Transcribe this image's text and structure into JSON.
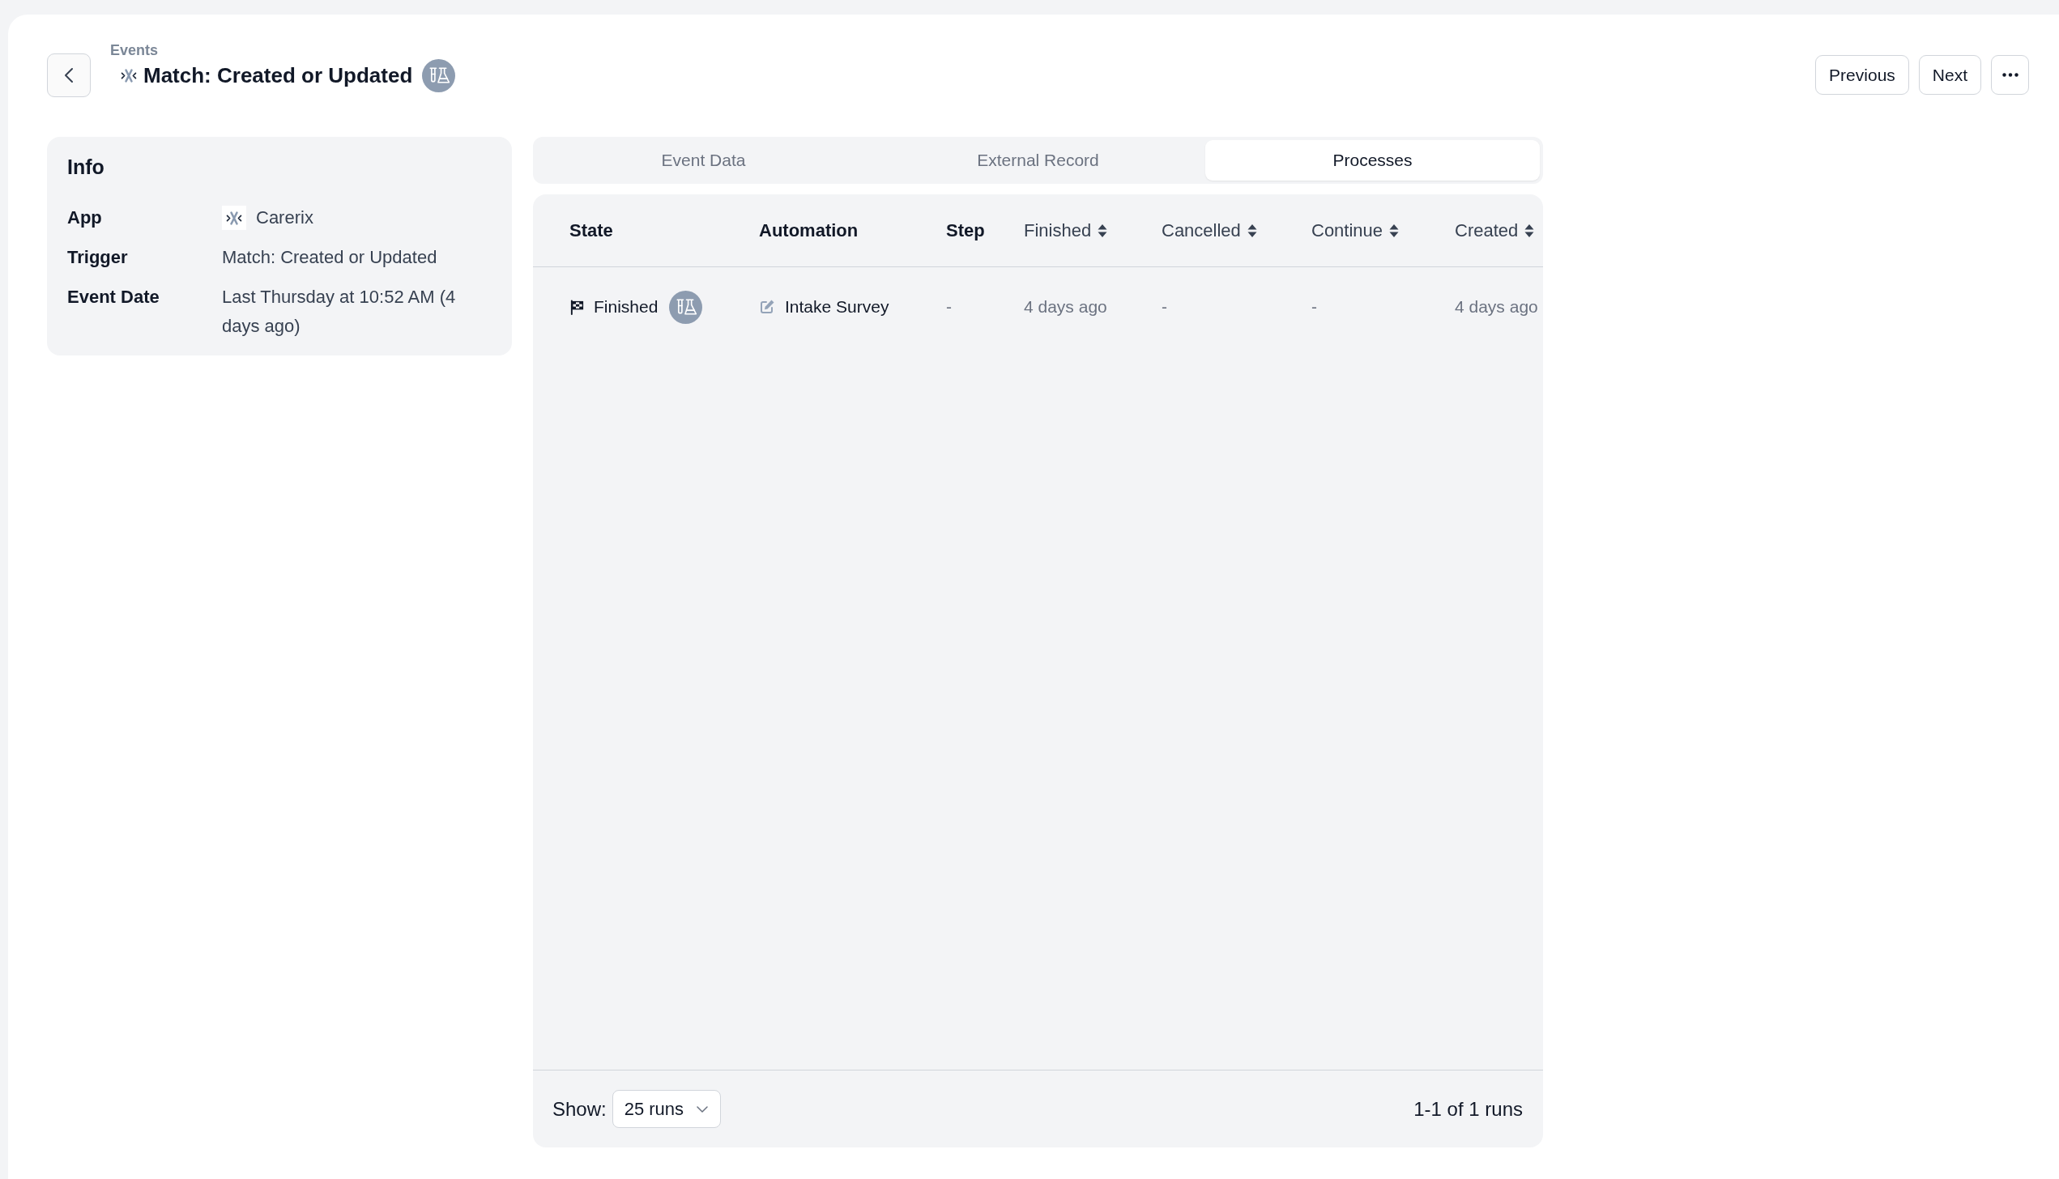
{
  "header": {
    "breadcrumb": "Events",
    "title": "Match: Created or Updated",
    "actions": [
      {
        "kind": "text",
        "label": "Previous"
      },
      {
        "kind": "text",
        "label": "Next"
      },
      {
        "kind": "more"
      }
    ]
  },
  "info": {
    "title": "Info",
    "rows": [
      {
        "kind": "app",
        "label": "App",
        "value": "Carerix"
      },
      {
        "kind": "text",
        "label": "Trigger",
        "value": "Match: Created or Updated"
      },
      {
        "kind": "text",
        "label": "Event Date",
        "value": "Last Thursday at 10:52 AM (4 days ago)"
      }
    ]
  },
  "tabs": [
    {
      "label": "Event Data",
      "selected": false
    },
    {
      "label": "External Record",
      "selected": false
    },
    {
      "label": "Processes",
      "selected": true
    }
  ],
  "table": {
    "columns": [
      {
        "label": "State",
        "sortable": false
      },
      {
        "label": "Automation",
        "sortable": false
      },
      {
        "label": "Step",
        "sortable": false
      },
      {
        "label": "Finished",
        "sortable": true
      },
      {
        "label": "Cancelled",
        "sortable": true
      },
      {
        "label": "Continue",
        "sortable": true
      },
      {
        "label": "Created",
        "sortable": true
      }
    ],
    "rows": [
      {
        "cells": [
          {
            "kind": "state",
            "text": "Finished"
          },
          {
            "kind": "automation",
            "text": "Intake Survey"
          },
          {
            "kind": "plain",
            "text": "-"
          },
          {
            "kind": "plain",
            "text": "4 days ago"
          },
          {
            "kind": "plain",
            "text": "-"
          },
          {
            "kind": "plain",
            "text": "-"
          },
          {
            "kind": "plain",
            "text": "4 days ago"
          }
        ]
      }
    ]
  },
  "footer": {
    "show_label": "Show:",
    "page_size": "25 runs",
    "summary": "1-1 of 1 runs"
  }
}
